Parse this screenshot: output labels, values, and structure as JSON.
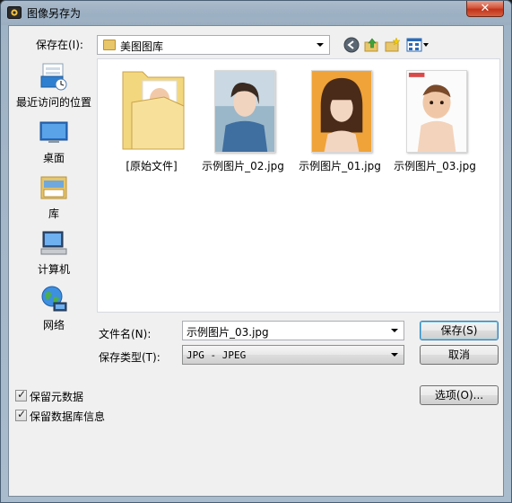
{
  "window": {
    "title": "图像另存为",
    "close_glyph": "✕"
  },
  "toolbar": {
    "save_in_label": "保存在(I):",
    "location": "美图图库"
  },
  "places": [
    {
      "label": "最近访问的位置",
      "icon": "recent-places-icon"
    },
    {
      "label": "桌面",
      "icon": "desktop-icon"
    },
    {
      "label": "库",
      "icon": "libraries-icon"
    },
    {
      "label": "计算机",
      "icon": "computer-icon"
    },
    {
      "label": "网络",
      "icon": "network-icon"
    }
  ],
  "files": [
    {
      "name": "[原始文件]",
      "type": "folder"
    },
    {
      "name": "示例图片_02.jpg",
      "type": "image"
    },
    {
      "name": "示例图片_01.jpg",
      "type": "image"
    },
    {
      "name": "示例图片_03.jpg",
      "type": "image"
    }
  ],
  "form": {
    "filename_label": "文件名(N):",
    "filename_value": "示例图片_03.jpg",
    "filetype_label": "保存类型(T):",
    "filetype_value": "JPG - JPEG"
  },
  "buttons": {
    "save": "保存(S)",
    "cancel": "取消",
    "options": "选项(O)..."
  },
  "checkboxes": [
    {
      "label": "保留元数据",
      "checked": true
    },
    {
      "label": "保留数据库信息",
      "checked": true
    }
  ]
}
